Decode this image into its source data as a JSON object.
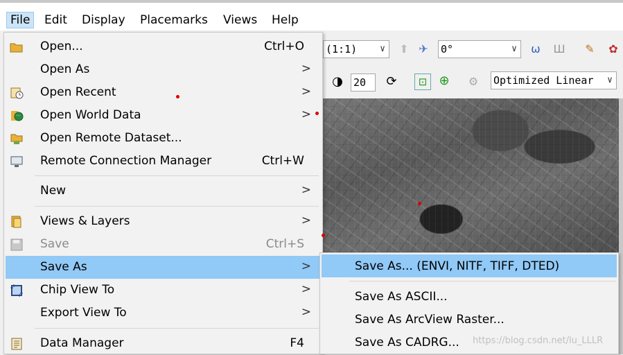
{
  "menubar": {
    "items": [
      "File",
      "Edit",
      "Display",
      "Placemarks",
      "Views",
      "Help"
    ],
    "active": "File"
  },
  "toolbar": {
    "zoom_value": "(1:1)",
    "rotation_value": "0°",
    "sharpen_value": "20",
    "stretch_value": "Optimized Linear"
  },
  "file_menu": {
    "items": [
      {
        "label": "Open...",
        "shortcut": "Ctrl+O",
        "icon": "folder-open-icon"
      },
      {
        "label": "Open As",
        "submenu": true
      },
      {
        "label": "Open Recent",
        "submenu": true,
        "icon": "recent-icon"
      },
      {
        "label": "Open World Data",
        "submenu": true,
        "icon": "globe-icon"
      },
      {
        "label": "Open Remote Dataset...",
        "icon": "remote-dataset-icon"
      },
      {
        "label": "Remote Connection Manager",
        "shortcut": "Ctrl+W",
        "icon": "monitor-icon"
      },
      {
        "label": "New",
        "submenu": true
      },
      {
        "label": "Views & Layers",
        "submenu": true,
        "icon": "layers-icon"
      },
      {
        "label": "Save",
        "shortcut": "Ctrl+S",
        "icon": "save-icon",
        "disabled": true
      },
      {
        "label": "Save As",
        "submenu": true,
        "highlighted": true
      },
      {
        "label": "Chip View To",
        "submenu": true,
        "icon": "chip-icon"
      },
      {
        "label": "Export View To",
        "submenu": true
      },
      {
        "label": "Data Manager",
        "shortcut": "F4",
        "icon": "data-manager-icon"
      }
    ],
    "submenu_arrow": ">"
  },
  "save_as_submenu": {
    "items": [
      {
        "label": "Save As... (ENVI, NITF, TIFF, DTED)",
        "highlighted": true
      },
      {
        "label": "Save As ASCII..."
      },
      {
        "label": "Save As ArcView Raster..."
      },
      {
        "label": "Save As CADRG..."
      }
    ]
  },
  "watermark": "https://blog.csdn.net/lu_LLLR",
  "colors": {
    "highlight": "#91c9f7",
    "menu_bg": "#f2f2f2",
    "menubar_active": "#cce4f7"
  }
}
